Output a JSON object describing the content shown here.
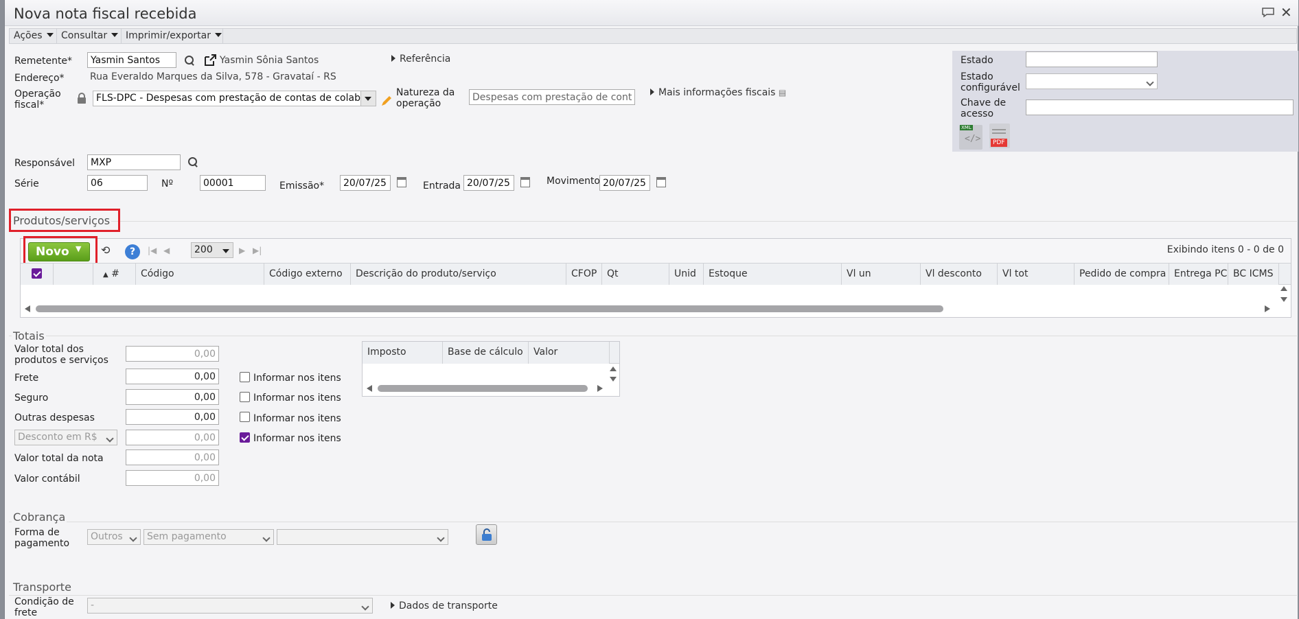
{
  "window": {
    "title": "Nova nota fiscal recebida"
  },
  "menu": {
    "acoes": "Ações",
    "consultar": "Consultar",
    "imprimir": "Imprimir/exportar"
  },
  "header": {
    "remetente_label": "Remetente*",
    "remetente_value": "Yasmin Santos",
    "remetente_name": "Yasmin Sônia Santos",
    "referencia": "Referência",
    "endereco_label": "Endereço*",
    "endereco_value": "Rua Everaldo Marques da Silva, 578 - Gravataí - RS",
    "operacao_label": "Operação fiscal*",
    "operacao_value": "FLS-DPC - Despesas com prestação de contas de colaboradores",
    "natureza_label": "Natureza da operação",
    "natureza_value": "Despesas com prestação de contas",
    "mais_info": "Mais informações fiscais",
    "responsavel_label": "Responsável",
    "responsavel_value": "MXP",
    "serie_label": "Série",
    "serie_value": "06",
    "numero_label": "Nº",
    "numero_value": "00001",
    "emissao_label": "Emissão*",
    "emissao_value": "20/07/25",
    "entrada_label": "Entrada",
    "entrada_value": "20/07/25",
    "movimento_label": "Movimento",
    "movimento_value": "20/07/25"
  },
  "right_panel": {
    "estado_label": "Estado",
    "estado_config_label": "Estado configurável",
    "chave_label": "Chave de acesso",
    "xml_badge": "XML",
    "pdf_badge": "PDF"
  },
  "produtos": {
    "section_title": "Produtos/serviços",
    "novo_label": "Novo",
    "page_size": "200",
    "exibindo": "Exibindo itens 0 - 0 de 0",
    "columns": [
      "#",
      "Código",
      "Código externo",
      "Descrição do produto/serviço",
      "CFOP",
      "Qt",
      "Unid",
      "Estoque",
      "Vl un",
      "Vl desconto",
      "Vl tot",
      "Pedido de compra",
      "Entrega PC",
      "BC ICMS"
    ]
  },
  "totais": {
    "section_title": "Totais",
    "valor_total_label": "Valor total dos produtos e serviços",
    "valor_total_value": "0,00",
    "frete_label": "Frete",
    "frete_value": "0,00",
    "seguro_label": "Seguro",
    "seguro_value": "0,00",
    "outras_label": "Outras despesas",
    "outras_value": "0,00",
    "desconto_select": "Desconto em R$",
    "desconto_value": "0,00",
    "valor_nota_label": "Valor total da nota",
    "valor_nota_value": "0,00",
    "valor_contabil_label": "Valor contábil",
    "valor_contabil_value": "0,00",
    "informar": "Informar nos itens",
    "imposto_cols": [
      "Imposto",
      "Base de cálculo",
      "Valor"
    ]
  },
  "cobranca": {
    "section_title": "Cobrança",
    "forma_label": "Forma de pagamento",
    "forma_value": "Outros",
    "pagamento_value": "Sem pagamento"
  },
  "transporte": {
    "section_title": "Transporte",
    "condicao_label": "Condição de frete",
    "condicao_value": "-",
    "dados": "Dados de transporte"
  }
}
